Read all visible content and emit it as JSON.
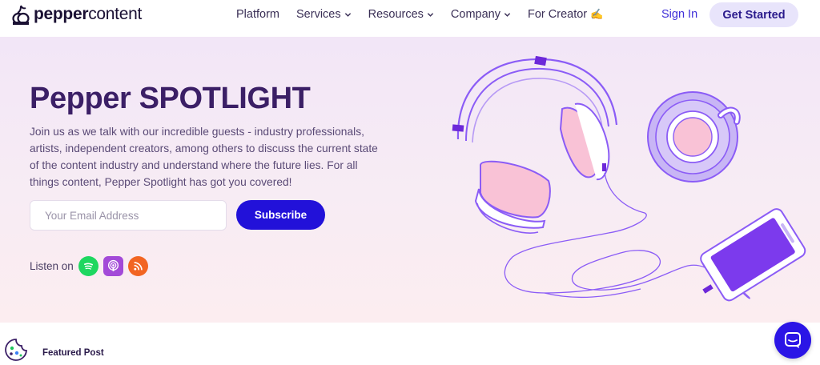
{
  "brand": {
    "bold": "pepper",
    "light": "content",
    "accent": "#2211d9"
  },
  "nav": {
    "items": [
      {
        "label": "Platform",
        "has_dropdown": false
      },
      {
        "label": "Services",
        "has_dropdown": true
      },
      {
        "label": "Resources",
        "has_dropdown": true
      },
      {
        "label": "Company",
        "has_dropdown": true
      },
      {
        "label": "For Creator",
        "has_dropdown": false,
        "emoji": "✍️"
      }
    ],
    "signin_label": "Sign In",
    "cta_label": "Get Started"
  },
  "hero": {
    "title": "Pepper SPOTLIGHT",
    "description": "Join us as we talk with our incredible guests - industry professionals, artists, independent creators, among others to discuss the current state of the content industry and understand where the future lies. For all things content, Pepper Spotlight has got you covered!",
    "email_placeholder": "Your Email Address",
    "subscribe_label": "Subscribe",
    "listen_label": "Listen on",
    "platform_icons": [
      "spotify-icon",
      "apple-podcasts-icon",
      "rss-icon"
    ]
  },
  "featured": {
    "label": "Featured Post"
  },
  "colors": {
    "spotify": "#1ed760",
    "apple_podcasts": "#a34ad8",
    "rss": "#f26522",
    "illustration_purple": "#8b5cf6",
    "illustration_pink": "#f9c2d6"
  }
}
